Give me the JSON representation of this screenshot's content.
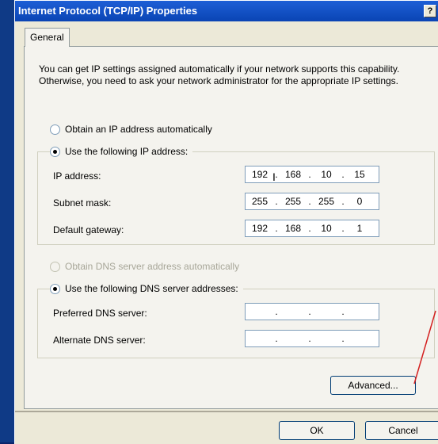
{
  "window": {
    "title": "Internet Protocol (TCP/IP) Properties",
    "help_label": "?"
  },
  "tabs": [
    {
      "label": "General"
    }
  ],
  "intro_text": "You can get IP settings assigned automatically if your network supports this capability. Otherwise, you need to ask your network administrator for the appropriate IP settings.",
  "ip_section": {
    "auto_label": "Obtain an IP address automatically",
    "manual_label": "Use the following IP address:",
    "selected": "manual",
    "fields": [
      {
        "label": "IP address:",
        "octets": [
          "192",
          "168",
          "10",
          "15"
        ]
      },
      {
        "label": "Subnet mask:",
        "octets": [
          "255",
          "255",
          "255",
          "0"
        ]
      },
      {
        "label": "Default gateway:",
        "octets": [
          "192",
          "168",
          "10",
          "1"
        ]
      }
    ]
  },
  "dns_section": {
    "auto_label": "Obtain DNS server address automatically",
    "auto_disabled": true,
    "manual_label": "Use the following DNS server addresses:",
    "selected": "manual",
    "fields": [
      {
        "label": "Preferred DNS server:",
        "octets": [
          "",
          "",
          "",
          ""
        ]
      },
      {
        "label": "Alternate DNS server:",
        "octets": [
          "",
          "",
          "",
          ""
        ]
      }
    ]
  },
  "buttons": {
    "advanced": "Advanced...",
    "ok": "OK",
    "cancel": "Cancel"
  },
  "annotation": {
    "color": "#d42020"
  }
}
